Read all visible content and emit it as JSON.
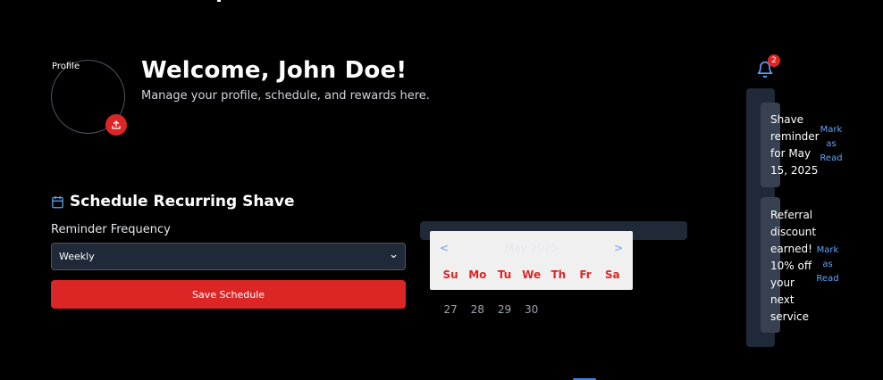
{
  "profile": {
    "avatar_label": "Profile",
    "welcome": "Welcome, John Doe!",
    "subtitle": "Manage your profile, schedule, and rewards here.",
    "upload_icon": "upload-icon"
  },
  "schedule": {
    "title": "Schedule Recurring Shave",
    "icon": "calendar-icon",
    "frequency_label": "Reminder Frequency",
    "frequency_value": "Weekly",
    "save_label": "Save Schedule"
  },
  "calendar": {
    "prev": "<",
    "next": ">",
    "month": "May 2025",
    "weekdays": [
      "Su",
      "Mo",
      "Tu",
      "We",
      "Th",
      "Fr",
      "Sa"
    ],
    "visible_days": [
      "27",
      "28",
      "29",
      "30"
    ]
  },
  "notifications": {
    "badge_count": "2",
    "items": [
      {
        "text": "Shave reminder for May 15, 2025",
        "action": "Mark as Read"
      },
      {
        "text": "Referral discount earned! 10% off your next service",
        "action": "Mark as Read"
      }
    ]
  },
  "colors": {
    "accent_red": "#dc2626",
    "link_blue": "#60a5fa",
    "panel": "#1f2937"
  }
}
